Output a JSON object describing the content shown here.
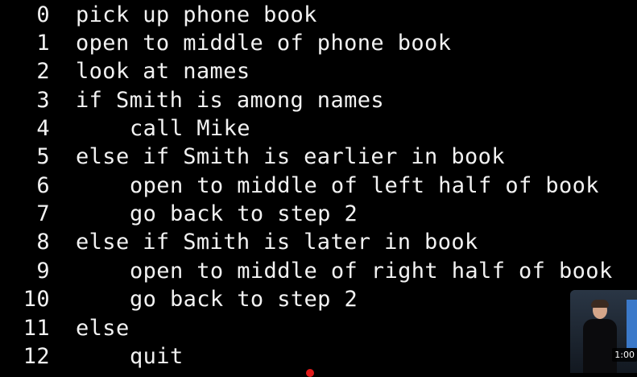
{
  "code_lines": [
    {
      "num": "0",
      "text": "pick up phone book"
    },
    {
      "num": "1",
      "text": "open to middle of phone book"
    },
    {
      "num": "2",
      "text": "look at names"
    },
    {
      "num": "3",
      "text": "if Smith is among names"
    },
    {
      "num": "4",
      "text": "call Mike"
    },
    {
      "num": "5",
      "text": "else if Smith is earlier in book"
    },
    {
      "num": "6",
      "text": "open to middle of left half of book"
    },
    {
      "num": "7",
      "text": "go back to step 2"
    },
    {
      "num": "8",
      "text": "else if Smith is later in book"
    },
    {
      "num": "9",
      "text": "open to middle of right half of book"
    },
    {
      "num": "10",
      "text": "go back to step 2"
    },
    {
      "num": "11",
      "text": "else"
    },
    {
      "num": "12",
      "text": "quit"
    }
  ],
  "video_thumbnail": {
    "timestamp": "1:00"
  },
  "colors": {
    "background": "#000000",
    "text": "#f2f2f2",
    "progress_dot": "#e01a1a"
  }
}
